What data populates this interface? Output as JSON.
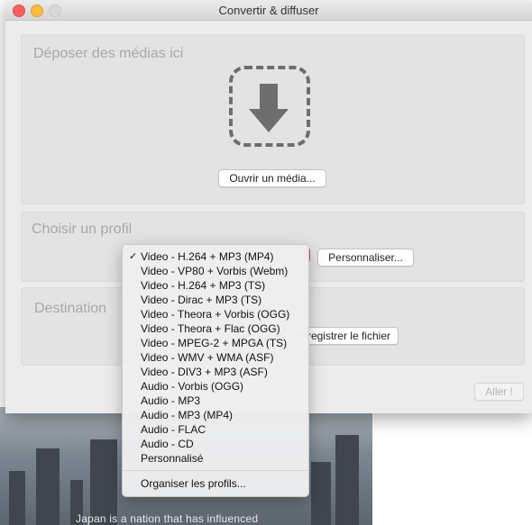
{
  "window": {
    "title": "Convertir & diffuser"
  },
  "sections": {
    "drop": {
      "title": "Déposer des médias ici",
      "open_button": "Ouvrir un média..."
    },
    "profile": {
      "title": "Choisir un profil",
      "customize_button": "Personnaliser..."
    },
    "destination": {
      "title": "Destination",
      "save_button": "Enregistrer le fichier"
    }
  },
  "go_button": "Aller !",
  "profile_menu": {
    "selected_index": 0,
    "checkmark": "✓",
    "items": [
      "Video - H.264 + MP3 (MP4)",
      "Video - VP80 + Vorbis (Webm)",
      "Video - H.264 + MP3 (TS)",
      "Video - Dirac + MP3 (TS)",
      "Video - Theora + Vorbis (OGG)",
      "Video - Theora + Flac (OGG)",
      "Video - MPEG-2 + MPGA (TS)",
      "Video - WMV + WMA (ASF)",
      "Video - DIV3 + MP3 (ASF)",
      "Audio - Vorbis (OGG)",
      "Audio - MP3",
      "Audio - MP3 (MP4)",
      "Audio - FLAC",
      "Audio - CD",
      "Personnalisé"
    ],
    "manage_item": "Organiser les profils..."
  },
  "background": {
    "caption": "Japan is a nation that has influenced"
  },
  "colors": {
    "close": "#fc605c",
    "minimize": "#fdbc40",
    "select_accent": "#d9478b"
  }
}
